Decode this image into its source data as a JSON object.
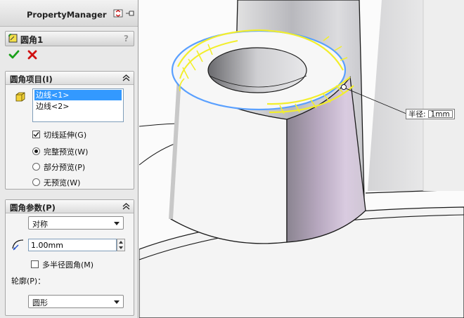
{
  "panel": {
    "title": "PropertyManager",
    "feature_name": "圆角1",
    "help_label": "?"
  },
  "items_group": {
    "header": "圆角项目(I)",
    "edges": [
      "边线<1>",
      "边线<2>"
    ],
    "tangent_propagation": {
      "label": "切线延伸(G)",
      "checked": true
    },
    "preview_options": [
      {
        "label": "完整预览(W)",
        "selected": true
      },
      {
        "label": "部分预览(P)",
        "selected": false
      },
      {
        "label": "无预览(W)",
        "selected": false
      }
    ]
  },
  "params_group": {
    "header": "圆角参数(P)",
    "type_value": "对称",
    "radius_value": "1.00mm",
    "multi_radius": {
      "label": "多半径圆角(M)",
      "checked": false
    },
    "profile_label": "轮廓(P)：",
    "profile_value": "圆形"
  },
  "callout": {
    "label": "半径:",
    "value": "1mm"
  },
  "colors": {
    "selection_highlight": "#3399ff",
    "edge_blue": "#5aa0ff",
    "preview_yellow": "#f2ee2c",
    "ok_green": "#1aa01a",
    "cancel_red": "#d01010"
  }
}
